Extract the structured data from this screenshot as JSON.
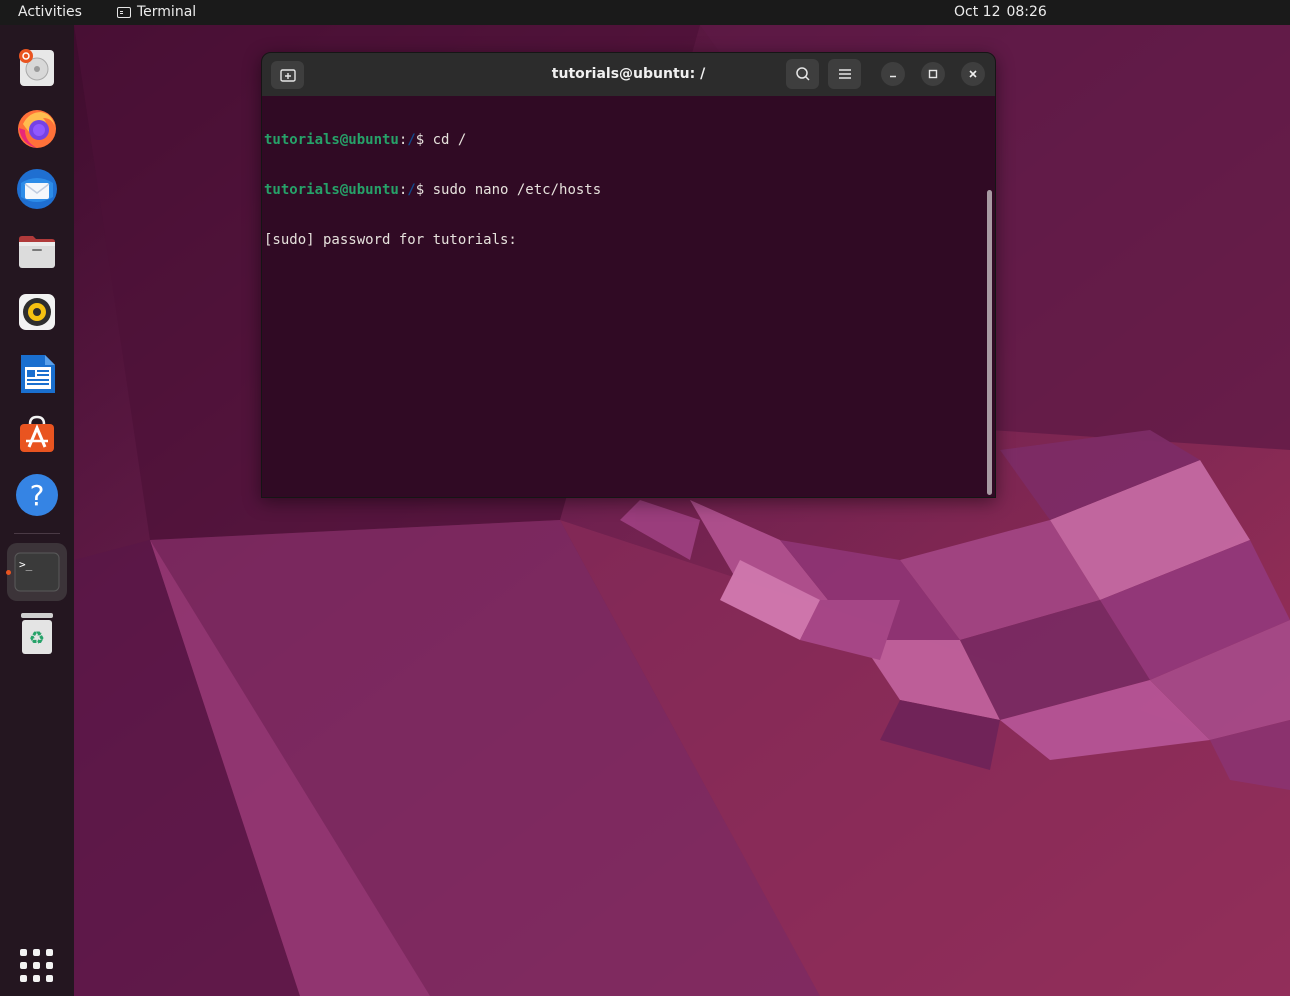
{
  "topbar": {
    "activities": "Activities",
    "app_name": "Terminal",
    "date": "Oct 12",
    "time": "08:26"
  },
  "dock": {
    "items": [
      {
        "name": "ubuntu-installer",
        "icon": "installer-icon"
      },
      {
        "name": "firefox",
        "icon": "firefox-icon"
      },
      {
        "name": "thunderbird",
        "icon": "thunderbird-icon"
      },
      {
        "name": "files",
        "icon": "folder-icon"
      },
      {
        "name": "rhythmbox",
        "icon": "rhythmbox-icon"
      },
      {
        "name": "libreoffice-writer",
        "icon": "writer-icon"
      },
      {
        "name": "ubuntu-software",
        "icon": "software-icon"
      },
      {
        "name": "help",
        "icon": "help-icon",
        "glyph": "?"
      },
      {
        "name": "terminal",
        "icon": "terminal-icon",
        "glyph": ">_",
        "running": true
      },
      {
        "name": "trash",
        "icon": "trash-icon",
        "glyph": "♻"
      }
    ],
    "show_apps_icon": "apps-grid-icon"
  },
  "terminal": {
    "title": "tutorials@ubuntu: /",
    "lines": [
      {
        "user": "tutorials@ubuntu",
        "colon": ":",
        "path": "/",
        "cmd": "$ cd /"
      },
      {
        "user": "tutorials@ubuntu",
        "colon": ":",
        "path": "/",
        "cmd": "$ sudo nano /etc/hosts"
      },
      {
        "text": "[sudo] password for tutorials:"
      }
    ]
  },
  "colors": {
    "accent": "#e95420",
    "terminal_bg": "#300a24",
    "prompt_user": "#26a269",
    "prompt_path": "#12488b"
  }
}
